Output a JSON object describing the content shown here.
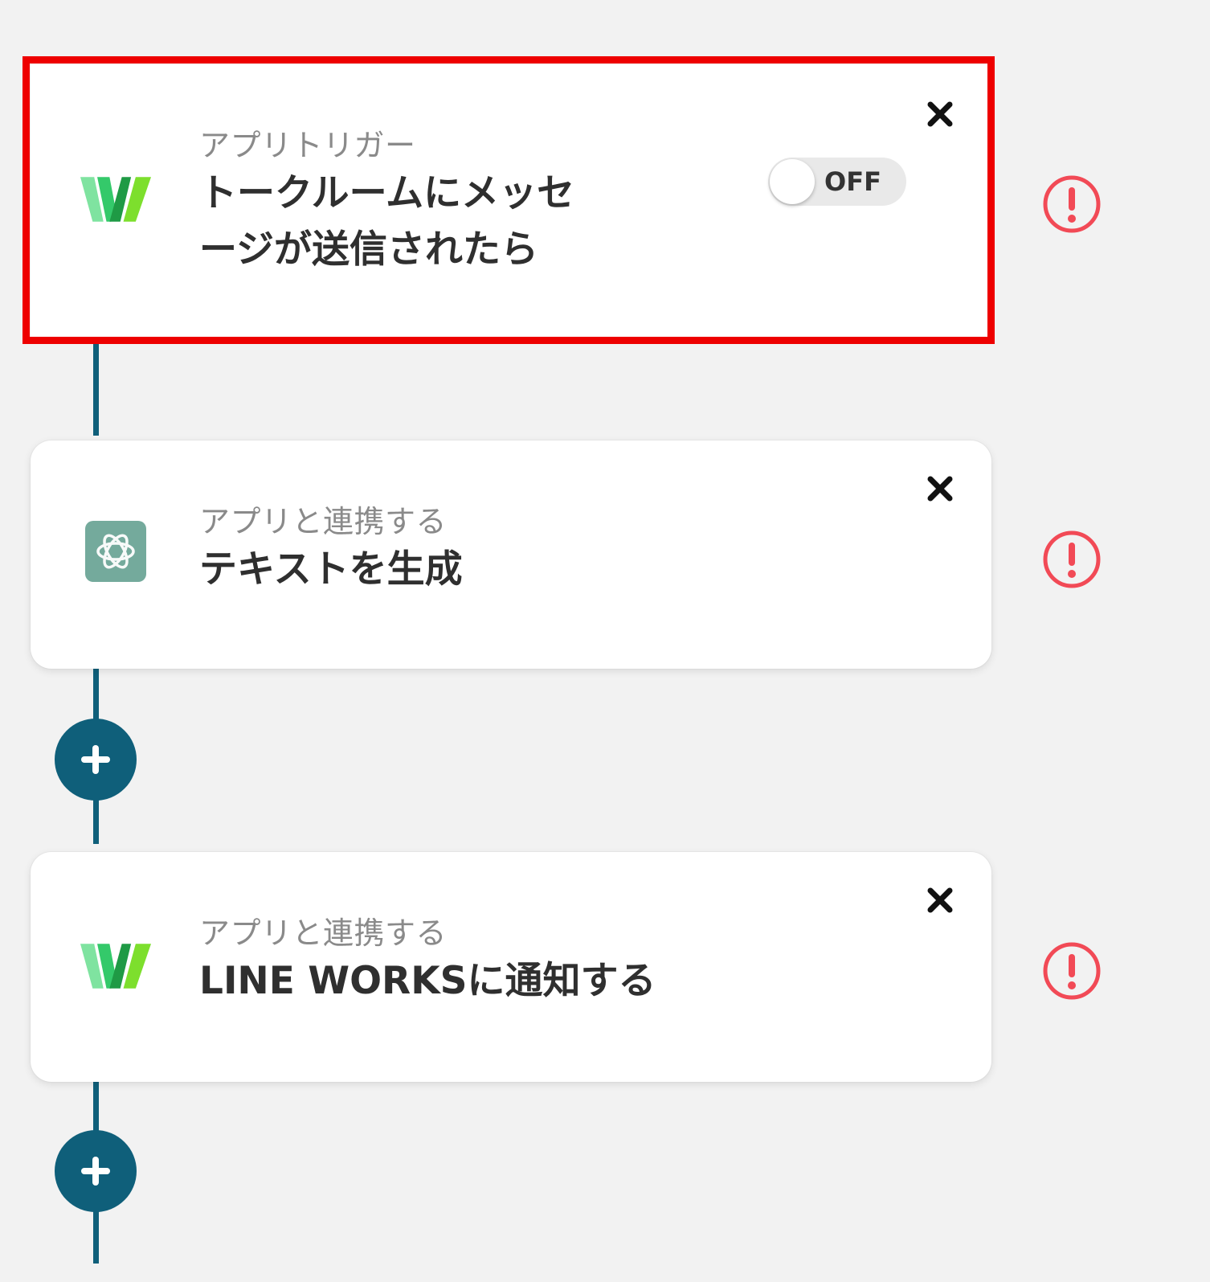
{
  "flow": {
    "steps": [
      {
        "app_icon": "line-works-icon",
        "subtitle": "アプリトリガー",
        "title_line1": "トークルームにメッセ",
        "title_line2": "ージが送信されたら",
        "toggle_label": "OFF",
        "toggle_state": "off",
        "selected": true,
        "status_icon": "warning-icon"
      },
      {
        "app_icon": "chatgpt-icon",
        "subtitle": "アプリと連携する",
        "title": "テキストを生成",
        "status_icon": "warning-icon"
      },
      {
        "app_icon": "line-works-icon",
        "subtitle": "アプリと連携する",
        "title": "LINE WORKSに通知する",
        "status_icon": "warning-icon"
      }
    ],
    "add_button_icon": "plus-icon",
    "close_icon": "close-icon"
  },
  "colors": {
    "background": "#f2f2f2",
    "card": "#ffffff",
    "accent": "#0f5f7a",
    "highlight": "#ee0000",
    "warning": "#f24a56",
    "line_works_green": "#1fc34e"
  }
}
